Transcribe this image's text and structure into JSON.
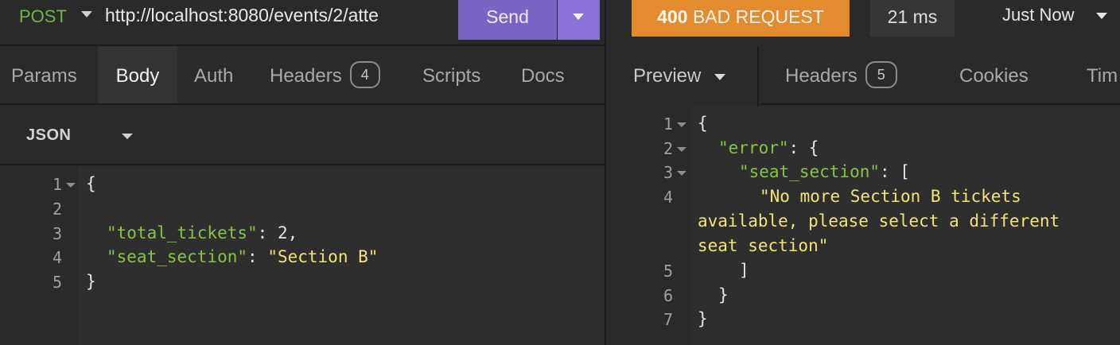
{
  "request": {
    "method": "POST",
    "url": "http://localhost:8080/events/2/atte",
    "send_label": "Send",
    "tabs": [
      {
        "label": "Params"
      },
      {
        "label": "Body"
      },
      {
        "label": "Auth"
      },
      {
        "label": "Headers",
        "badge": "4"
      },
      {
        "label": "Scripts"
      },
      {
        "label": "Docs"
      }
    ],
    "body_type": "JSON",
    "body_lines": {
      "numbers": [
        "1",
        "2",
        "3",
        "4",
        "5"
      ],
      "l1": "{",
      "k1": "\"total_tickets\"",
      "v1": "2,",
      "k2": "\"seat_section\"",
      "v2": "\"Section B\"",
      "l5": "}"
    }
  },
  "response": {
    "status_code": "400",
    "status_text": "BAD REQUEST",
    "time": "21 ms",
    "when": "Just Now",
    "tabs": [
      {
        "label": "Preview"
      },
      {
        "label": "Headers",
        "badge": "5"
      },
      {
        "label": "Cookies"
      },
      {
        "label": "Tim"
      }
    ],
    "body_lines": {
      "numbers": [
        "1",
        "2",
        "3",
        "4",
        "5",
        "6",
        "7"
      ],
      "l1": "{",
      "k_error": "\"error\"",
      "l2_tail": ": {",
      "k_seat": "\"seat_section\"",
      "l3_tail": ": [",
      "msg1": "\"No more Section B tickets",
      "msg2": "available, please select a different",
      "msg3": "seat section\"",
      "l5": "]",
      "l6": "}",
      "l7": "}"
    }
  },
  "colors": {
    "send": "#7b65c4",
    "status": "#e38b2f",
    "json_key": "#87c441",
    "json_string": "#f3e477",
    "method": "#73b34a"
  }
}
